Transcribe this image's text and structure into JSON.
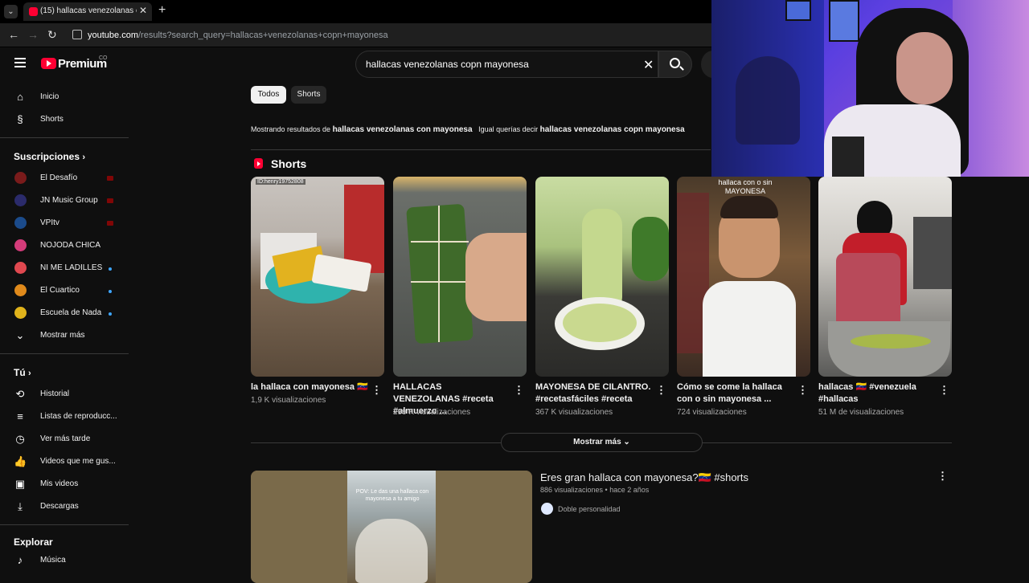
{
  "browser": {
    "tab_title": "(15) hallacas venezolanas copn",
    "tab_close": "✕",
    "new_tab": "+",
    "url_host": "youtube.com",
    "url_path": "/results?search_query=hallacas+venezolanas+copn+mayonesa"
  },
  "header": {
    "brand": "Premium",
    "country": "CO",
    "search_value": "hallacas venezolanas copn mayonesa"
  },
  "sidebar": {
    "main": [
      {
        "label": "Inicio"
      },
      {
        "label": "Shorts"
      }
    ],
    "subscriptions_title": "Suscripciones",
    "subscriptions": [
      {
        "label": "El Desafío",
        "avatar_color": "#7a1b1b"
      },
      {
        "label": "JN Music Group",
        "avatar_color": "#2b2b6b"
      },
      {
        "label": "VPItv",
        "avatar_color": "#1b4b8b"
      },
      {
        "label": "NOJODA CHICA",
        "avatar_color": "#d43c7a"
      },
      {
        "label": "NI ME LADILLES",
        "avatar_color": "#e0484f"
      },
      {
        "label": "El Cuartico",
        "avatar_color": "#e08a1b"
      },
      {
        "label": "Escuela de Nada",
        "avatar_color": "#e0b31b"
      }
    ],
    "show_more": "Mostrar más",
    "you_title": "Tú",
    "you": [
      {
        "label": "Historial"
      },
      {
        "label": "Listas de reproducc..."
      },
      {
        "label": "Ver más tarde"
      },
      {
        "label": "Videos que me gus..."
      },
      {
        "label": "Mis videos"
      },
      {
        "label": "Descargas"
      }
    ],
    "explore_title": "Explorar",
    "explore": [
      {
        "label": "Música"
      }
    ]
  },
  "filters": {
    "all": "Todos",
    "shorts": "Shorts"
  },
  "suggestion": {
    "showing": "Mostrando resultados de",
    "corrected": "hallacas venezolanas con mayonesa",
    "instead": "Igual querías decir",
    "original": "hallacas venezolanas copn mayonesa"
  },
  "shorts_section": {
    "title": "Shorts",
    "items": [
      {
        "title": "la hallaca con mayonesa 🇻🇪",
        "views": "1,9 K visualizaciones",
        "overlay": "ID:henry19752808"
      },
      {
        "title": "HALLACAS VENEZOLANAS #receta #almuerzo ...",
        "views": "299 K visualizaciones"
      },
      {
        "title": "MAYONESA DE CILANTRO. #recetasfáciles #receta",
        "views": "367 K visualizaciones"
      },
      {
        "title": "Cómo se come la hallaca con o sin mayonesa ...",
        "views": "724 visualizaciones",
        "overlay": "hallaca con o sin MAYONESA"
      },
      {
        "title": "hallacas 🇻🇪 #venezuela #hallacas",
        "views": "51 M de visualizaciones"
      }
    ],
    "show_more": "Mostrar más"
  },
  "video_result": {
    "title": "Eres gran hallaca con mayonesa?🇻🇪 #shorts",
    "meta": "886 visualizaciones • hace 2 años",
    "channel": "Doble personalidad",
    "thumb_text": "POV: Le das una hallaca con mayonesa a tu amigo"
  },
  "colors": {
    "background": "#0f0f0f",
    "accent": "#ff0033"
  }
}
